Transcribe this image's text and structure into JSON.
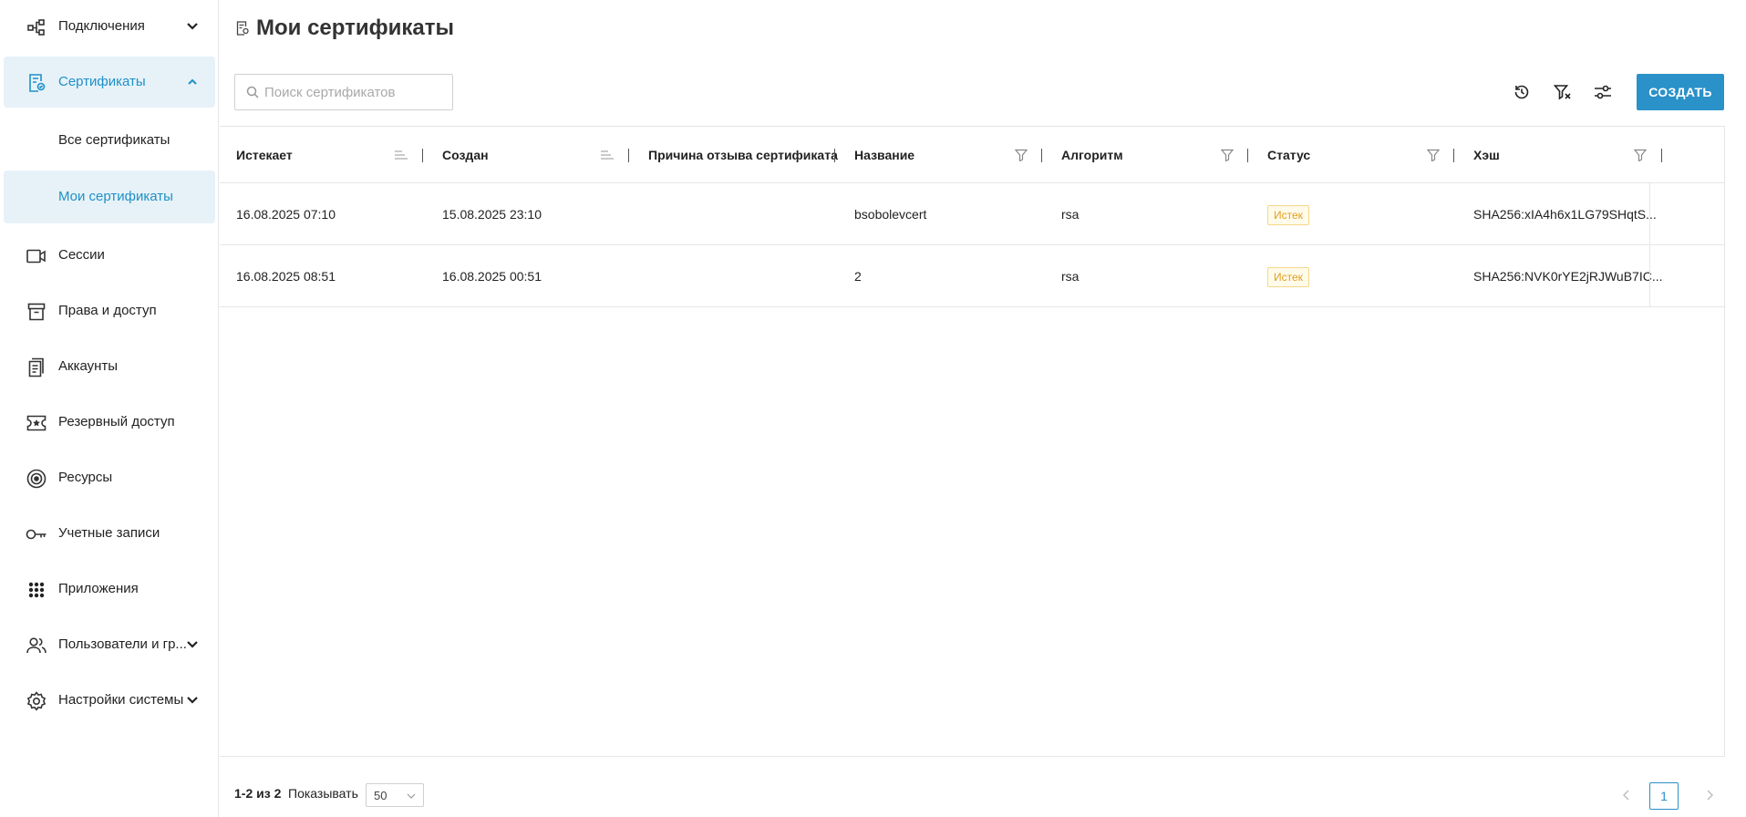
{
  "sidebar": {
    "items": [
      {
        "label": "Подключения",
        "icon": "connections-icon"
      },
      {
        "label": "Сертификаты",
        "icon": "certificate-icon"
      },
      {
        "label": "Все сертификаты"
      },
      {
        "label": "Мои сертификаты"
      },
      {
        "label": "Сессии",
        "icon": "video-camera-icon"
      },
      {
        "label": "Права и доступ",
        "icon": "archive-icon"
      },
      {
        "label": "Аккаунты",
        "icon": "document-icon"
      },
      {
        "label": "Резервный доступ",
        "icon": "ticket-star-icon"
      },
      {
        "label": "Ресурсы",
        "icon": "target-icon"
      },
      {
        "label": "Учетные записи",
        "icon": "key-icon"
      },
      {
        "label": "Приложения",
        "icon": "grid-dots-icon"
      },
      {
        "label": "Пользователи и гр...",
        "icon": "users-icon"
      },
      {
        "label": "Настройки системы",
        "icon": "gear-icon"
      }
    ]
  },
  "header": {
    "title": "Мои сертификаты"
  },
  "search": {
    "placeholder": "Поиск сертификатов",
    "value": ""
  },
  "toolbar": {
    "create_label": "СОЗДАТЬ"
  },
  "table": {
    "columns": [
      {
        "label": "Истекает"
      },
      {
        "label": "Создан"
      },
      {
        "label": "Причина отзыва сертификата"
      },
      {
        "label": "Название"
      },
      {
        "label": "Алгоритм"
      },
      {
        "label": "Статус"
      },
      {
        "label": "Хэш"
      }
    ],
    "rows": [
      {
        "expires": "16.08.2025 07:10",
        "created": "15.08.2025 23:10",
        "reason": "",
        "name": "bsobolevcert",
        "algorithm": "rsa",
        "status": "Истек",
        "hash": "SHA256:xIA4h6x1LG79SHqtS..."
      },
      {
        "expires": "16.08.2025 08:51",
        "created": "16.08.2025 00:51",
        "reason": "",
        "name": "2",
        "algorithm": "rsa",
        "status": "Истек",
        "hash": "SHA256:NVK0rYE2jRJWuB7IC..."
      }
    ]
  },
  "footer": {
    "count": "1-2 из 2",
    "show_label": "Показывать",
    "page_size": "50",
    "current_page": "1"
  },
  "colors": {
    "accent": "#2a91c9",
    "active_bg": "#e6f2f8",
    "status_expired": "#e0a020"
  }
}
